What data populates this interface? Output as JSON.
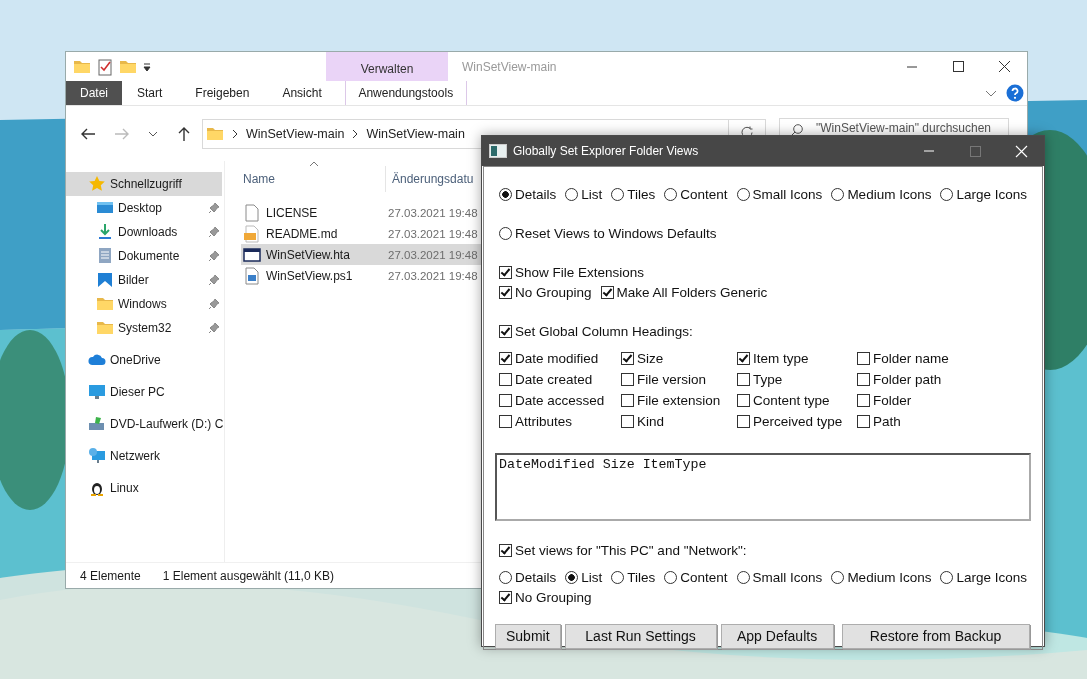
{
  "explorer": {
    "title": "WinSetView-main",
    "context_tab": "Verwalten",
    "ribbon_tabs": [
      {
        "label": "Datei",
        "selected": true
      },
      {
        "label": "Start",
        "selected": false
      },
      {
        "label": "Freigeben",
        "selected": false
      },
      {
        "label": "Ansicht",
        "selected": false
      },
      {
        "label": "Anwendungstools",
        "selected": false
      }
    ],
    "path": [
      "WinSetView-main",
      "WinSetView-main"
    ],
    "search": {
      "placeholder": "\"WinSetView-main\" durchsuchen"
    },
    "sidebar": {
      "items": [
        {
          "label": "Schnellzugriff",
          "kind": "star",
          "pinned": false,
          "selected": true,
          "children": [
            {
              "label": "Desktop",
              "kind": "desktop",
              "pinned": true,
              "selected": false
            },
            {
              "label": "Downloads",
              "kind": "download",
              "pinned": true,
              "selected": false
            },
            {
              "label": "Dokumente",
              "kind": "document",
              "pinned": true,
              "selected": false
            },
            {
              "label": "Bilder",
              "kind": "pictures",
              "pinned": true,
              "selected": false
            },
            {
              "label": "Windows",
              "kind": "folder",
              "pinned": true,
              "selected": false
            },
            {
              "label": "System32",
              "kind": "folder",
              "pinned": true,
              "selected": false
            }
          ]
        },
        {
          "label": "OneDrive",
          "kind": "cloud",
          "pinned": false,
          "selected": false
        },
        {
          "label": "Dieser PC",
          "kind": "pc",
          "pinned": false,
          "selected": false
        },
        {
          "label": "DVD-Laufwerk (D:) C",
          "kind": "dvd",
          "pinned": false,
          "selected": false
        },
        {
          "label": "Netzwerk",
          "kind": "network",
          "pinned": false,
          "selected": false
        },
        {
          "label": "Linux",
          "kind": "linux",
          "pinned": false,
          "selected": false
        }
      ]
    },
    "columns": [
      "Name",
      "Änderungsdatu"
    ],
    "files": [
      {
        "name": "LICENSE",
        "date": "27.03.2021 19:48",
        "kind": "file",
        "selected": false
      },
      {
        "name": "README.md",
        "date": "27.03.2021 19:48",
        "kind": "markdown",
        "selected": false
      },
      {
        "name": "WinSetView.hta",
        "date": "27.03.2021 19:48",
        "kind": "app",
        "selected": true
      },
      {
        "name": "WinSetView.ps1",
        "date": "27.03.2021 19:48",
        "kind": "script",
        "selected": false
      }
    ],
    "status_bar": [
      "4 Elemente",
      "1 Element ausgewählt (11,0 KB)"
    ]
  },
  "dialog": {
    "title": "Globally Set Explorer Folder Views",
    "rows": [
      {
        "kind": "radios",
        "items": [
          {
            "label": "Details",
            "selected": true
          },
          {
            "label": "List",
            "selected": false
          },
          {
            "label": "Tiles",
            "selected": false
          },
          {
            "label": "Content",
            "selected": false
          },
          {
            "label": "Small Icons",
            "selected": false
          },
          {
            "label": "Medium Icons",
            "selected": false
          },
          {
            "label": "Large Icons",
            "selected": false
          }
        ]
      },
      {
        "kind": "radios",
        "items": [
          {
            "label": "Reset Views to Windows Defaults",
            "selected": false
          }
        ]
      },
      {
        "kind": "checks",
        "items": [
          {
            "label": "Show File Extensions",
            "checked": true
          }
        ]
      },
      {
        "kind": "checks",
        "items": [
          {
            "label": "No Grouping",
            "checked": true
          },
          {
            "label": "Make All Folders Generic",
            "checked": true
          }
        ]
      },
      {
        "kind": "checks",
        "items": [
          {
            "label": "Set Global Column Headings:",
            "checked": true
          }
        ]
      },
      {
        "kind": "grid",
        "items": [
          {
            "label": "Date modified",
            "checked": true
          },
          {
            "label": "Size",
            "checked": true
          },
          {
            "label": "Item type",
            "checked": true
          },
          {
            "label": "Folder name",
            "checked": false
          },
          {
            "label": "Date created",
            "checked": false
          },
          {
            "label": "File version",
            "checked": false
          },
          {
            "label": "Type",
            "checked": false
          },
          {
            "label": "Folder path",
            "checked": false
          },
          {
            "label": "Date accessed",
            "checked": false
          },
          {
            "label": "File extension",
            "checked": false
          },
          {
            "label": "Content type",
            "checked": false
          },
          {
            "label": "Folder",
            "checked": false
          },
          {
            "label": "Attributes",
            "checked": false
          },
          {
            "label": "Kind",
            "checked": false
          },
          {
            "label": "Perceived type",
            "checked": false
          },
          {
            "label": "Path",
            "checked": false
          }
        ]
      },
      {
        "kind": "textarea",
        "value": "DateModified Size ItemType"
      },
      {
        "kind": "checks",
        "items": [
          {
            "label": "Set views for \"This PC\" and \"Network\":",
            "checked": true
          }
        ]
      },
      {
        "kind": "radios",
        "items": [
          {
            "label": "Details",
            "selected": false
          },
          {
            "label": "List",
            "selected": true
          },
          {
            "label": "Tiles",
            "selected": false
          },
          {
            "label": "Content",
            "selected": false
          },
          {
            "label": "Small Icons",
            "selected": false
          },
          {
            "label": "Medium Icons",
            "selected": false
          },
          {
            "label": "Large Icons",
            "selected": false
          }
        ]
      },
      {
        "kind": "checks",
        "items": [
          {
            "label": "No Grouping",
            "checked": true
          }
        ]
      },
      {
        "kind": "buttons",
        "items": [
          "Submit",
          "Last Run Settings",
          "App Defaults",
          "Restore from Backup"
        ]
      }
    ]
  }
}
